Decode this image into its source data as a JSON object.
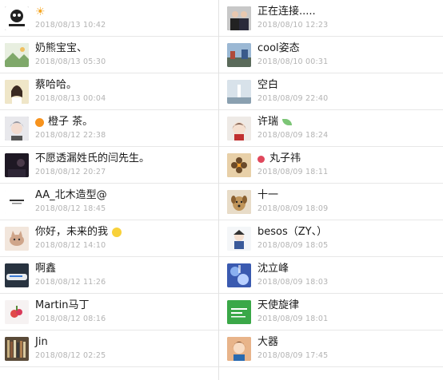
{
  "left": [
    {
      "name": "",
      "time": "2018/08/13 10:42",
      "badge": "sun-icon",
      "avatar_bg": "#2b2b2b",
      "avatar_icon": "panda-meme-avatar"
    },
    {
      "name": "奶熊宝宝、",
      "time": "2018/08/13 05:30",
      "avatar_bg": "#9cb98a",
      "avatar_icon": "landscape-avatar"
    },
    {
      "name": "蔡哈哈。",
      "time": "2018/08/13 00:04",
      "avatar_bg": "#d8c89a",
      "avatar_icon": "girl-avatar"
    },
    {
      "name": "橙子 茶。",
      "time": "2018/08/12 22:38",
      "badge": "orange-icon",
      "avatar_bg": "#7a7a80",
      "avatar_icon": "grey-hair-avatar"
    },
    {
      "name": "不愿透漏姓氏的闫先生。",
      "time": "2018/08/12 20:27",
      "avatar_bg": "#2a2430",
      "avatar_icon": "dark-photo-avatar"
    },
    {
      "name": "AA_北木造型@",
      "time": "2018/08/12 18:45",
      "avatar_bg": "#f4f4f4",
      "avatar_icon": "salon-logo-avatar"
    },
    {
      "name": "你好，未来的我",
      "time": "2018/08/12 14:10",
      "badge_after": "smiley-icon",
      "avatar_bg": "#e6d2c0",
      "avatar_icon": "cat-avatar"
    },
    {
      "name": "啊鑫",
      "time": "2018/08/12 11:26",
      "avatar_bg": "#3c4a5a",
      "avatar_icon": "train-avatar"
    },
    {
      "name": "Martin马丁",
      "time": "2018/08/12 08:16",
      "avatar_bg": "#f3eeee",
      "avatar_icon": "fruit-avatar"
    },
    {
      "name": "Jin",
      "time": "2018/08/12 02:25",
      "avatar_bg": "#6b5a46",
      "avatar_icon": "bookshelf-avatar"
    }
  ],
  "right": [
    {
      "name": "正在连接.....",
      "time": "2018/08/10 12:23",
      "avatar_bg": "#4a4e5a",
      "avatar_icon": "two-men-avatar"
    },
    {
      "name": "cool姿态",
      "time": "2018/08/10 00:31",
      "avatar_bg": "#6e8db0",
      "avatar_icon": "street-avatar"
    },
    {
      "name": "空白",
      "time": "2018/08/09 22:40",
      "avatar_bg": "#c9d3da",
      "avatar_icon": "lighthouse-avatar"
    },
    {
      "name": "许瑞",
      "time": "2018/08/09 18:24",
      "badge_after": "leaf-icon",
      "avatar_bg": "#d9d4d0",
      "avatar_icon": "cartoon-girl-avatar"
    },
    {
      "name": "丸子祎",
      "time": "2018/08/09 18:11",
      "badge": "red-dot-icon",
      "avatar_bg": "#c99a5a",
      "avatar_icon": "flower-avatar"
    },
    {
      "name": "十一",
      "time": "2018/08/09 18:09",
      "avatar_bg": "#b8956a",
      "avatar_icon": "dog-avatar"
    },
    {
      "name": "besos（ZY、）",
      "time": "2018/08/09 18:05",
      "avatar_bg": "#eef2f5",
      "avatar_icon": "cartoon-boy-avatar"
    },
    {
      "name": "沈立峰",
      "time": "2018/08/09 18:03",
      "avatar_bg": "#5a7bc8",
      "avatar_icon": "abstract-blue-avatar"
    },
    {
      "name": "天使旋律",
      "time": "2018/08/09 18:01",
      "avatar_bg": "#3daa4a",
      "avatar_icon": "green-card-avatar"
    },
    {
      "name": "大器",
      "time": "2018/08/09 17:45",
      "avatar_bg": "#c98a5a",
      "avatar_icon": "anime-avatar"
    }
  ]
}
